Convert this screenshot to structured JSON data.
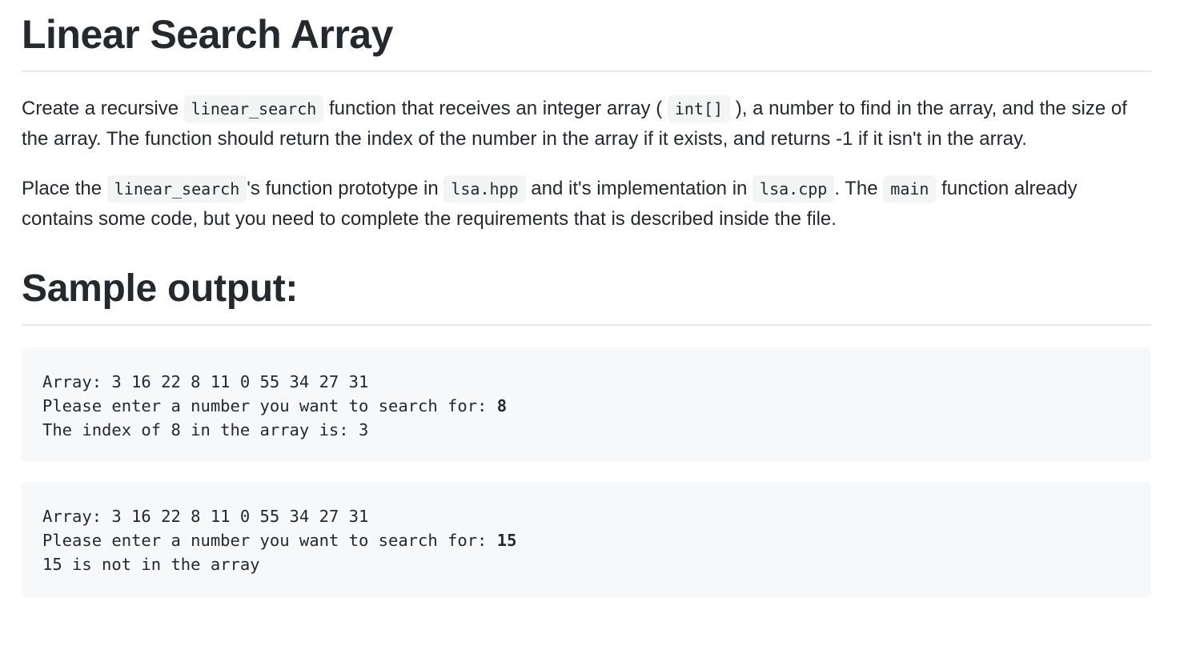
{
  "title": "Linear Search Array",
  "paragraph1": {
    "t1": "Create a recursive ",
    "code1": "linear_search",
    "t2": " function that receives an integer array ( ",
    "code2": "int[]",
    "t3": " ), a number to find in the array, and the size of the array. The function should return the index of the number in the array if it exists, and returns -1 if it isn't in the array."
  },
  "paragraph2": {
    "t1": "Place the ",
    "code1": "linear_search",
    "t2": "'s function prototype in ",
    "code2": "lsa.hpp",
    "t3": " and it's implementation in ",
    "code3": "lsa.cpp",
    "t4": ". The ",
    "code4": "main",
    "t5": " function already contains some code, but you need to complete the requirements that is described inside the file."
  },
  "section_heading": "Sample output:",
  "samples": [
    {
      "array_line": "Array: 3 16 22 8 11 0 55 34 27 31",
      "prompt": "Please enter a number you want to search for: ",
      "input": "8",
      "result": "The index of 8 in the array is: 3"
    },
    {
      "array_line": "Array: 3 16 22 8 11 0 55 34 27 31",
      "prompt": "Please enter a number you want to search for: ",
      "input": "15",
      "result": "15 is not in the array"
    }
  ]
}
